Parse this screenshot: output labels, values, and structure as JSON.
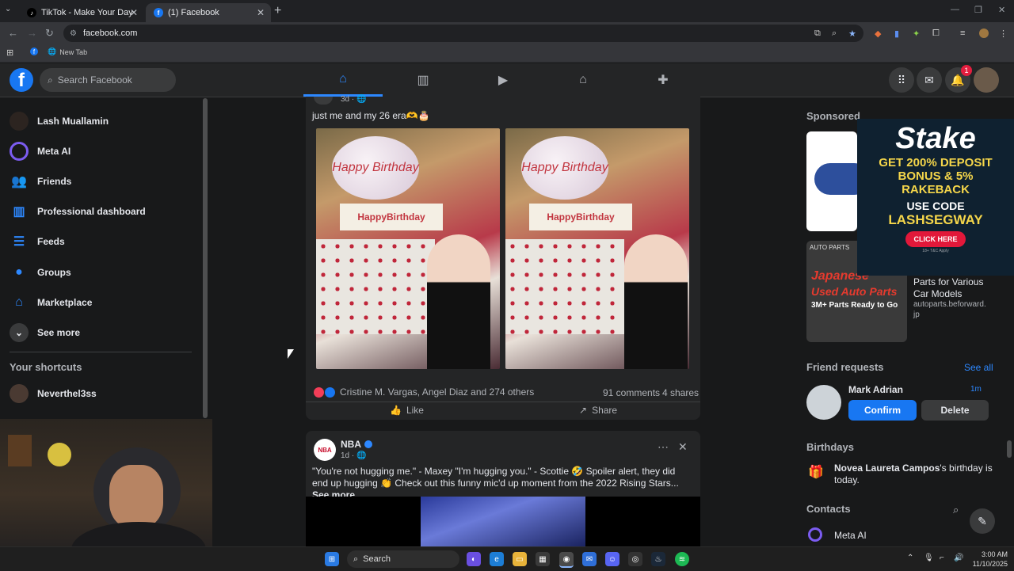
{
  "browser": {
    "tabs": [
      {
        "title": "TikTok - Make Your Day",
        "active": false
      },
      {
        "title": "(1) Facebook",
        "active": true
      }
    ],
    "url": "facebook.com",
    "bookmarks": [
      {
        "label": "New Tab"
      }
    ]
  },
  "fb": {
    "search_placeholder": "Search Facebook",
    "notification_count": "1"
  },
  "sidebar": {
    "items": [
      {
        "label": "Lash Muallamin",
        "icon": "avatar"
      },
      {
        "label": "Meta AI",
        "icon": "meta-ai-icon"
      },
      {
        "label": "Friends",
        "icon": "friends-icon"
      },
      {
        "label": "Professional dashboard",
        "icon": "dashboard-icon"
      },
      {
        "label": "Feeds",
        "icon": "feeds-icon"
      },
      {
        "label": "Groups",
        "icon": "groups-icon"
      },
      {
        "label": "Marketplace",
        "icon": "marketplace-icon"
      },
      {
        "label": "See more",
        "icon": "chevron-down-icon"
      }
    ],
    "shortcuts_heading": "Your shortcuts",
    "shortcuts": [
      {
        "label": "Neverthel3ss"
      }
    ]
  },
  "post1": {
    "time": "3d · ",
    "caption": "just me and my 26 era🫶🎂",
    "sign_text": "HappyBirthday",
    "balloon_text": "Happy Birthday",
    "reactions_text": "Cristine M. Vargas, Angel Diaz and 274 others",
    "comments": "91 comments",
    "shares": "4 shares",
    "like_label": "Like",
    "share_label": "Share"
  },
  "post2": {
    "author": "NBA",
    "time": "1d · ",
    "text": "\"You're not hugging me.\" - Maxey \"I'm hugging you.\" - Scottie 🤣 Spoiler alert, they did end up hugging 👏 Check out this funny mic'd up moment from the 2022 Rising Stars...",
    "see_more": "See more"
  },
  "right": {
    "sponsored": "Sponsored",
    "ad2_title": "Parts for Various Car Models",
    "ad2_domain": "autoparts.beforward.jp",
    "ad2_banner_line1": "Japanese",
    "ad2_banner_line2": "Used Auto Parts",
    "ad2_banner_line3": "3M+ Parts Ready to Go",
    "friend_requests": "Friend requests",
    "see_all": "See all",
    "fr_name": "Mark Adrian",
    "fr_time": "1m",
    "confirm": "Confirm",
    "delete": "Delete",
    "birthdays": "Birthdays",
    "bday_name": "Novea Laureta Campos",
    "bday_rest": "'s birthday is today.",
    "contacts": "Contacts",
    "contact1": "Meta AI"
  },
  "stake_ad": {
    "brand": "Stake",
    "line1": "GET 200% DEPOSIT",
    "line2": "BONUS & 5%",
    "line3": "RAKEBACK",
    "line4": "USE CODE",
    "code": "LASHSEGWAY",
    "cta": "CLICK HERE",
    "fine": "18+ T&C Apply"
  },
  "taskbar": {
    "search": "Search",
    "time": "3:00 AM",
    "date": "11/10/2025"
  },
  "colors": {
    "accent": "#1877f2",
    "bg": "#18191a",
    "card": "#242526"
  }
}
